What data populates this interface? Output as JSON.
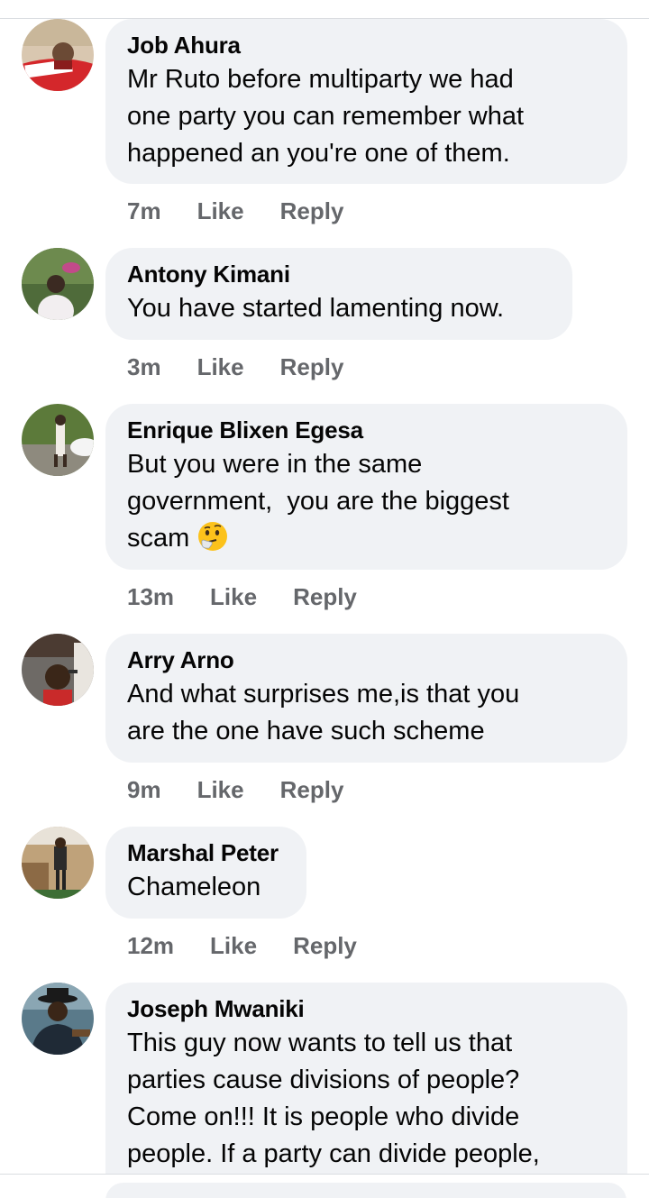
{
  "comments": [
    {
      "author": "Job Ahura",
      "text": "Mr Ruto before multiparty we had\none party you can remember what\nhappened an you're one of them.",
      "time": "7m",
      "like_label": "Like",
      "reply_label": "Reply"
    },
    {
      "author": "Antony Kimani",
      "text": "You have started lamenting now.",
      "time": "3m",
      "like_label": "Like",
      "reply_label": "Reply"
    },
    {
      "author": "Enrique Blixen Egesa",
      "text": "But you were in the same\ngovernment,  you are the biggest\nscam",
      "emoji": "thinking-face-icon",
      "time": "13m",
      "like_label": "Like",
      "reply_label": "Reply"
    },
    {
      "author": "Arry Arno",
      "text": "And what surprises me,is that you\nare the one have such scheme",
      "time": "9m",
      "like_label": "Like",
      "reply_label": "Reply"
    },
    {
      "author": "Marshal Peter",
      "text": "Chameleon",
      "time": "12m",
      "like_label": "Like",
      "reply_label": "Reply"
    },
    {
      "author": "Joseph Mwaniki",
      "text": "This guy now wants to tell us that\nparties cause divisions of people?\nCome on!!! It is people who divide\npeople. If a party can divide people,"
    }
  ],
  "colors": {
    "bubble_bg": "#f0f2f5",
    "secondary_text": "#65676b",
    "primary_text": "#050505"
  }
}
